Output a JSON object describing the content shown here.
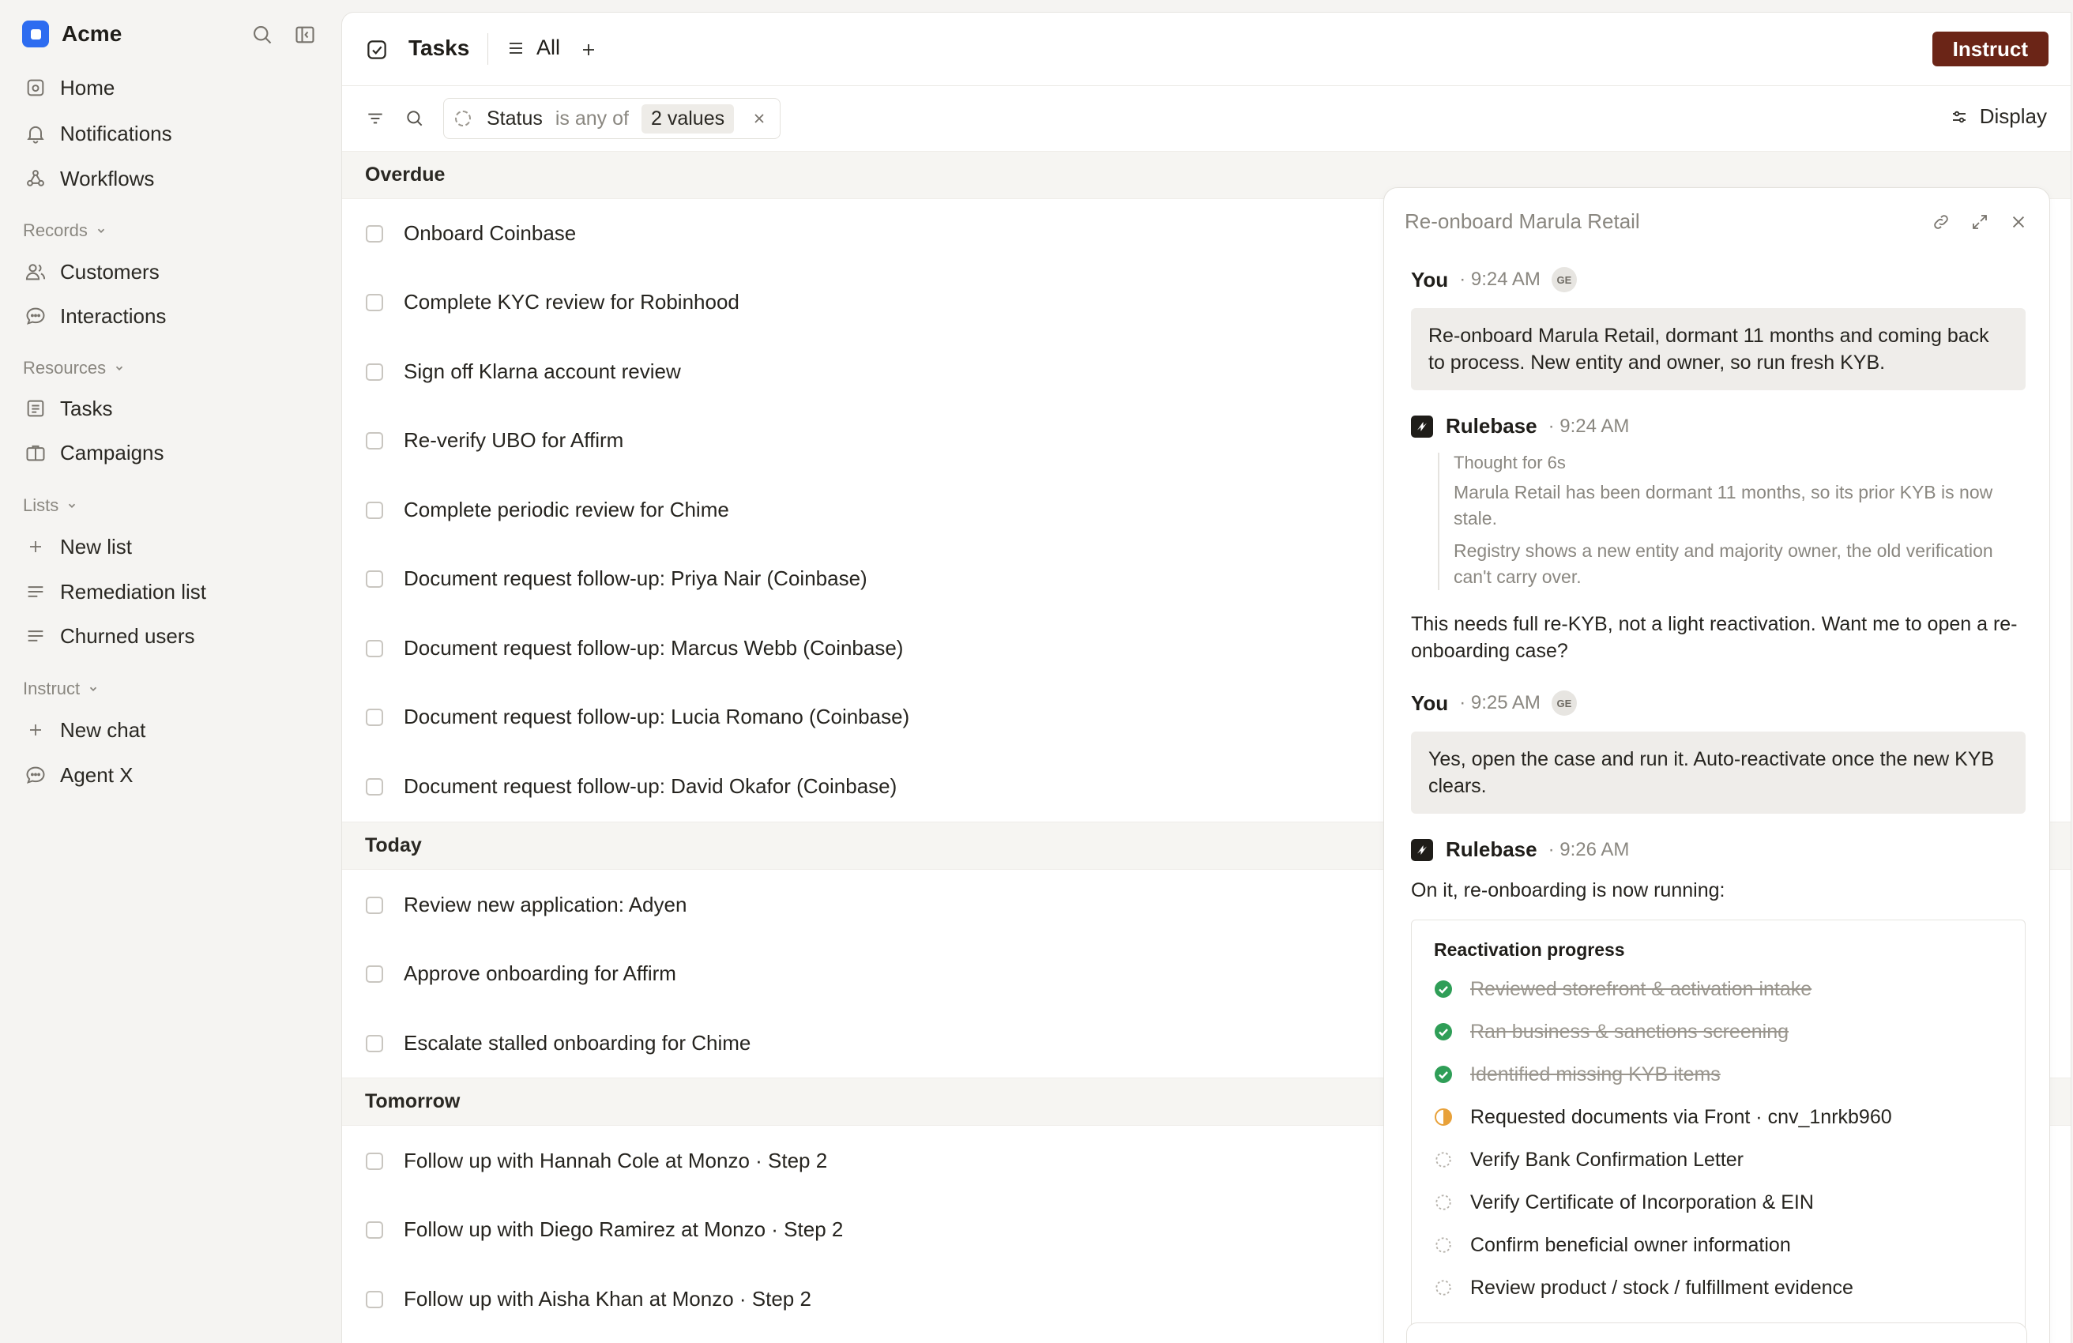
{
  "sidebar": {
    "brand": "Acme",
    "nav": [
      {
        "label": "Home",
        "icon": "home-icon"
      },
      {
        "label": "Notifications",
        "icon": "bell-icon"
      },
      {
        "label": "Workflows",
        "icon": "workflow-icon"
      }
    ],
    "records_heading": "Records",
    "records": [
      {
        "label": "Customers",
        "icon": "users-icon"
      },
      {
        "label": "Interactions",
        "icon": "chat-bubble-icon"
      }
    ],
    "resources_heading": "Resources",
    "resources": [
      {
        "label": "Tasks",
        "icon": "checklist-icon"
      },
      {
        "label": "Campaigns",
        "icon": "briefcase-icon"
      }
    ],
    "lists_heading": "Lists",
    "lists": [
      {
        "label": "New list",
        "icon": "plus-icon"
      },
      {
        "label": "Remediation list",
        "icon": "list-icon"
      },
      {
        "label": "Churned users",
        "icon": "list-icon"
      }
    ],
    "instruct_heading": "Instruct",
    "instruct": [
      {
        "label": "New chat",
        "icon": "plus-icon"
      },
      {
        "label": "Agent X",
        "icon": "chat-bubble-icon"
      }
    ]
  },
  "header": {
    "title": "Tasks",
    "view": "All",
    "instruct_button": "Instruct"
  },
  "filter": {
    "field": "Status",
    "operator": "is any of",
    "values": "2 values",
    "display_button": "Display"
  },
  "groups": [
    {
      "name": "Overdue",
      "tasks": [
        "Onboard Coinbase",
        "Complete KYC review for Robinhood",
        "Sign off Klarna account review",
        "Re-verify UBO for Affirm",
        "Complete periodic review for Chime",
        "Document request follow-up: Priya Nair (Coinbase)",
        "Document request follow-up: Marcus Webb (Coinbase)",
        "Document request follow-up: Lucia Romano (Coinbase)",
        "Document request follow-up: David Okafor (Coinbase)"
      ]
    },
    {
      "name": "Today",
      "tasks": [
        "Review new application: Adyen",
        "Approve onboarding for Affirm",
        "Escalate stalled onboarding for Chime"
      ]
    },
    {
      "name": "Tomorrow",
      "tasks": [
        "Follow up with Hannah Cole at Monzo · Step 2",
        "Follow up with Diego Ramirez at Monzo · Step 2",
        "Follow up with Aisha Khan at Monzo · Step 2"
      ]
    }
  ],
  "chat": {
    "title": "Re-onboard Marula Retail",
    "messages": [
      {
        "author": "You",
        "time": "· 9:24 AM",
        "avatar": "GE",
        "text": "Re-onboard Marula Retail,  dormant 11 months and coming back to process. New entity and owner, so run fresh KYB."
      },
      {
        "author": "Rulebase",
        "time": "· 9:24 AM",
        "thought_label": "Thought for 6s",
        "thoughts": [
          "Marula Retail has been dormant 11 months, so its prior KYB is now stale.",
          "Registry shows a new entity and majority owner, the old verification can't carry over."
        ],
        "text": "This needs full re-KYB, not a light reactivation. Want me to open a re-onboarding case?"
      },
      {
        "author": "You",
        "time": "· 9:25 AM",
        "avatar": "GE",
        "text": "Yes, open the case and run it. Auto-reactivate once the new KYB clears."
      },
      {
        "author": "Rulebase",
        "time": "· 9:26 AM",
        "text": "On it, re-onboarding is now running:"
      }
    ],
    "progress": {
      "title": "Reactivation progress",
      "steps": [
        {
          "label": "Reviewed storefront & activation intake",
          "status": "done"
        },
        {
          "label": "Ran business & sanctions screening",
          "status": "done"
        },
        {
          "label": "Identified missing KYB items",
          "status": "done"
        },
        {
          "label": "Requested documents via Front · cnv_1nrkb960",
          "status": "in-progress"
        },
        {
          "label": "Verify Bank Confirmation Letter",
          "status": "pending"
        },
        {
          "label": "Verify Certificate of Incorporation & EIN",
          "status": "pending"
        },
        {
          "label": "Confirm beneficial owner information",
          "status": "pending"
        },
        {
          "label": "Review product / stock / fulfillment evidence",
          "status": "pending"
        }
      ]
    }
  },
  "colors": {
    "brand": "#2d6cf0",
    "instruct_button": "#6b2517",
    "done_check": "#2f9e57",
    "in_progress": "#e8a13a"
  }
}
